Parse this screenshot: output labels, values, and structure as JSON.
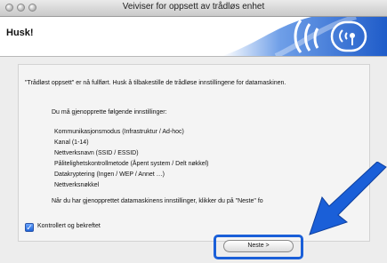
{
  "window": {
    "title": "Veiviser for oppsett av trådløs enhet"
  },
  "header": {
    "title": "Husk!",
    "banner_icon": "wireless-signal-icon"
  },
  "content": {
    "intro": "\"Trådløst oppsett\" er nå fullført. Husk å tilbakestille de trådløse innstillingene for datamaskinen.",
    "subheading": "Du må gjenopprette følgende innstillinger:",
    "settings": [
      "Kommunikasjonsmodus (Infrastruktur / Ad-hoc)",
      "Kanal (1-14)",
      "Nettverksnavn (SSID / ESSID)",
      "Pålitelighetskontrollmetode (Åpent system / Delt nøkkel)",
      "Datakryptering (Ingen / WEP / Annet …)",
      "Nettverksnøkkel"
    ],
    "footer": "Når du har gjenopprettet datamaskinens innstillinger, klikker du på \"Neste\" fo"
  },
  "checkbox": {
    "label": "Kontrollert og bekreftet",
    "checked": true
  },
  "buttons": {
    "next": "Neste >"
  },
  "colors": {
    "accent": "#1a5fd8",
    "banner": "#1f5cc9"
  }
}
